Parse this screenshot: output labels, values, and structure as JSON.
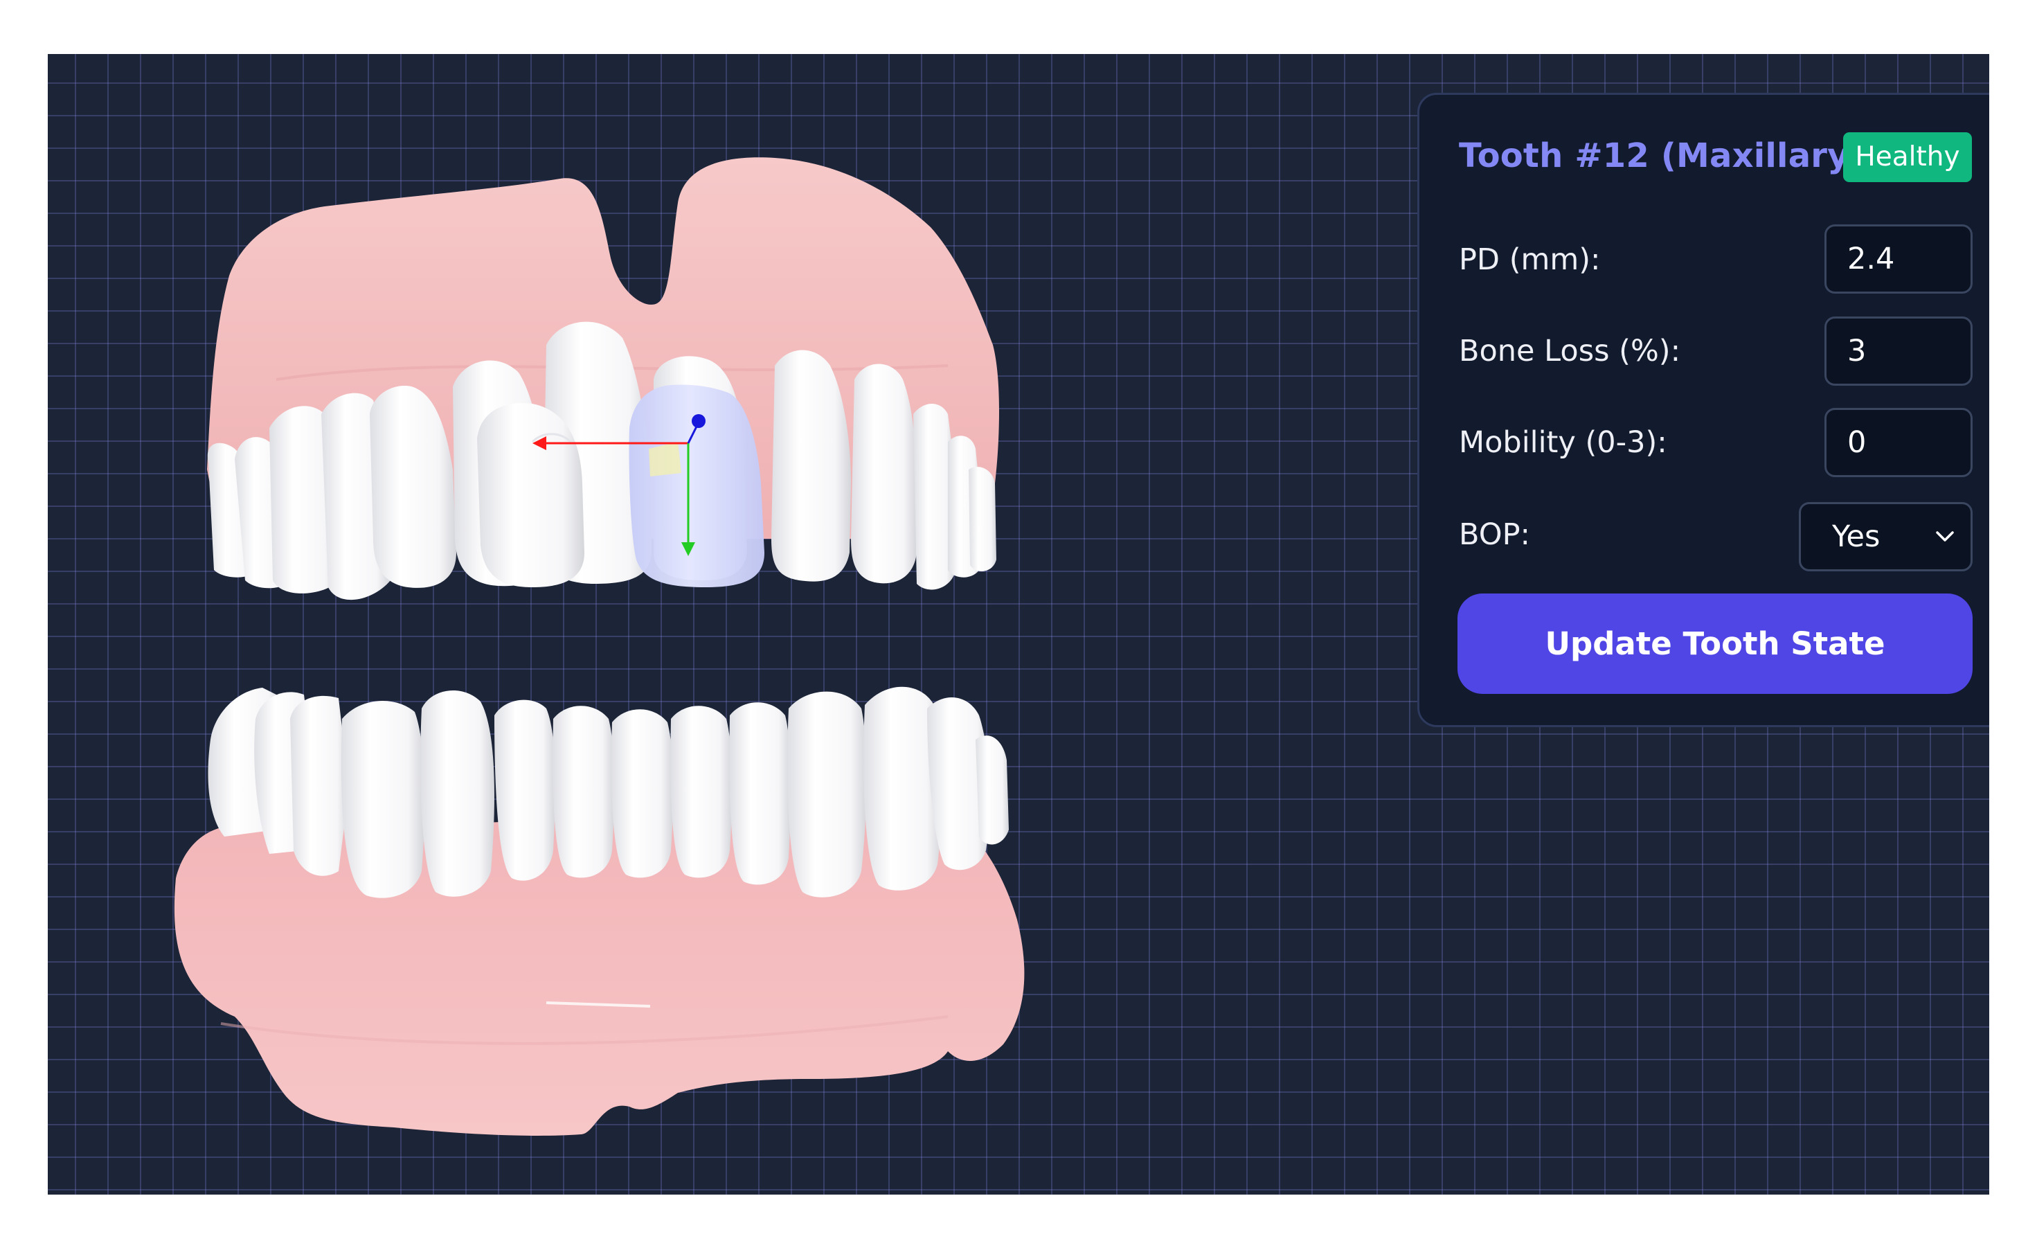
{
  "tooth_panel": {
    "title": "Tooth #12 (Maxillary)",
    "status_badge": "Healthy",
    "status_color": "#10b77f",
    "accent_color": "#5045e5",
    "fields": [
      {
        "label": "PD (mm):",
        "value": "2.4"
      },
      {
        "label": "Bone Loss (%):",
        "value": "3"
      },
      {
        "label": "Mobility (0-3):",
        "value": "0"
      }
    ],
    "bop": {
      "label": "BOP:",
      "selected": "Yes"
    },
    "update_button": "Update Tooth State"
  },
  "viewer": {
    "selected_tooth_highlight": "#d8dcfb",
    "gizmo_axes": {
      "x": "#ff1a1a",
      "y": "#22cc22",
      "z": "#1818dd"
    },
    "icons": [
      "chevron-down-icon",
      "transform-gizmo-icon"
    ]
  }
}
